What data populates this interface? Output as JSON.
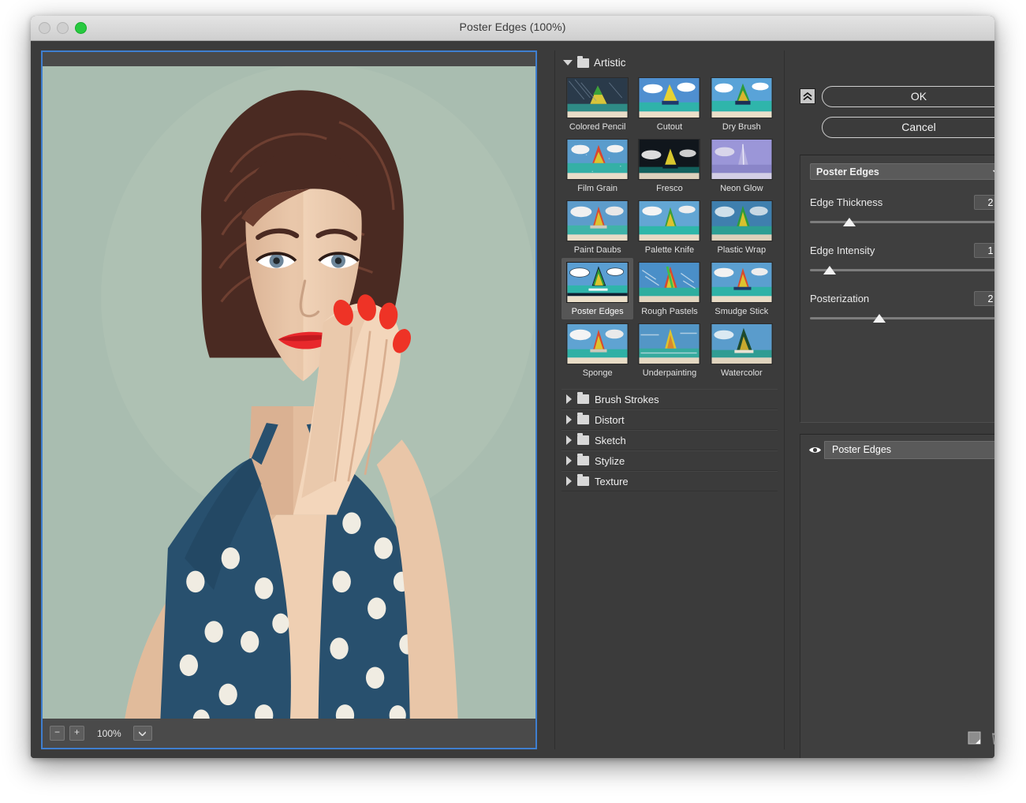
{
  "window": {
    "title": "Poster Edges (100%)",
    "traffic_lights": [
      "close-disabled",
      "minimize-disabled",
      "zoom-green"
    ]
  },
  "preview": {
    "zoom_out_label": "−",
    "zoom_in_label": "+",
    "zoom_level": "100%",
    "zoom_menu_icon": "chevron-down-icon",
    "image_description": "Posterized illustration of a woman with vintage updo hairstyle, red lips and nails, navy polka-dot halter top on sage green background",
    "colors": {
      "background": "#a9bdb0",
      "skin": "#f3d6bb",
      "skin_shadow": "#d9b295",
      "hair": "#4a2a22",
      "hair_light": "#7a4636",
      "lips": "#e8282c",
      "dress": "#28506e",
      "dress_dark": "#1c3a52",
      "dots": "#f0ece2"
    }
  },
  "browser": {
    "expanded_category": {
      "name": "Artistic",
      "icon": "folder-icon",
      "toggle_icon": "triangle-down-icon"
    },
    "filters": [
      {
        "name": "Colored Pencil",
        "selected": false
      },
      {
        "name": "Cutout",
        "selected": false
      },
      {
        "name": "Dry Brush",
        "selected": false
      },
      {
        "name": "Film Grain",
        "selected": false
      },
      {
        "name": "Fresco",
        "selected": false
      },
      {
        "name": "Neon Glow",
        "selected": false
      },
      {
        "name": "Paint Daubs",
        "selected": false
      },
      {
        "name": "Palette Knife",
        "selected": false
      },
      {
        "name": "Plastic Wrap",
        "selected": false
      },
      {
        "name": "Poster Edges",
        "selected": true
      },
      {
        "name": "Rough Pastels",
        "selected": false
      },
      {
        "name": "Smudge Stick",
        "selected": false
      },
      {
        "name": "Sponge",
        "selected": false
      },
      {
        "name": "Underpainting",
        "selected": false
      },
      {
        "name": "Watercolor",
        "selected": false
      }
    ],
    "collapsed_categories": [
      {
        "name": "Brush Strokes",
        "icon": "folder-icon",
        "toggle_icon": "triangle-right-icon"
      },
      {
        "name": "Distort",
        "icon": "folder-icon",
        "toggle_icon": "triangle-right-icon"
      },
      {
        "name": "Sketch",
        "icon": "folder-icon",
        "toggle_icon": "triangle-right-icon"
      },
      {
        "name": "Stylize",
        "icon": "folder-icon",
        "toggle_icon": "triangle-right-icon"
      },
      {
        "name": "Texture",
        "icon": "folder-icon",
        "toggle_icon": "triangle-right-icon"
      }
    ]
  },
  "right_panel": {
    "collapse_icon": "double-chevron-up-icon",
    "ok_label": "OK",
    "cancel_label": "Cancel",
    "filter_select": {
      "value": "Poster Edges",
      "chevron_icon": "chevron-down-icon"
    },
    "parameters": [
      {
        "label": "Edge Thickness",
        "value": "2",
        "percent": 20
      },
      {
        "label": "Edge Intensity",
        "value": "1",
        "percent": 10
      },
      {
        "label": "Posterization",
        "value": "2",
        "percent": 35
      }
    ],
    "effect_layers": [
      {
        "name": "Poster Edges",
        "visible": true,
        "visibility_icon": "eye-icon"
      }
    ],
    "tools": [
      {
        "name": "new-effect-layer",
        "icon": "new-layer-icon"
      },
      {
        "name": "delete-effect-layer",
        "icon": "trash-icon"
      }
    ]
  }
}
